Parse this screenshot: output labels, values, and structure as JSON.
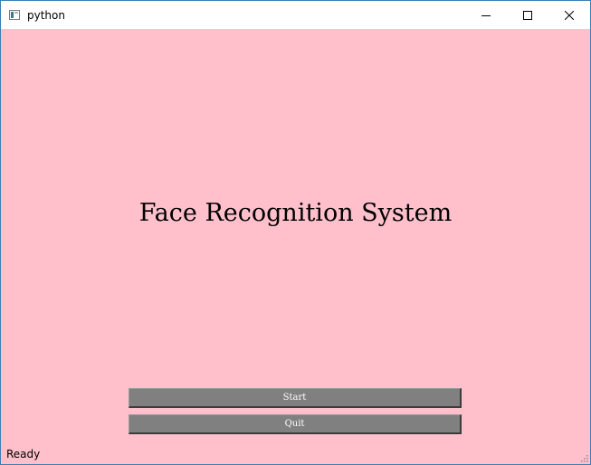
{
  "window": {
    "title": "python",
    "icon": "python-window-icon",
    "controls": {
      "minimize_icon": "minimize-icon",
      "maximize_icon": "maximize-icon",
      "close_icon": "close-icon"
    }
  },
  "main": {
    "headline": "Face Recognition System",
    "background_color": "#ffc0cb",
    "buttons": {
      "start_label": "Start",
      "quit_label": "Quit",
      "button_color": "#808080"
    }
  },
  "statusbar": {
    "text": "Ready",
    "grip_icon": "size-grip-icon"
  }
}
